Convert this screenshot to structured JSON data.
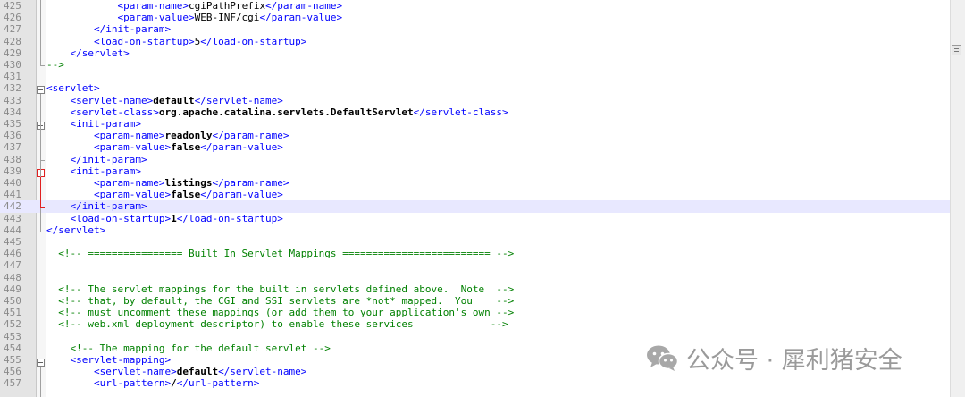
{
  "editor": {
    "lines": [
      {
        "n": "425",
        "code": [
          [
            "",
            "            "
          ],
          [
            "t",
            "<param-name>"
          ],
          [
            "",
            "cgiPathPrefix"
          ],
          [
            "t",
            "</param-name>"
          ]
        ]
      },
      {
        "n": "426",
        "code": [
          [
            "",
            "            "
          ],
          [
            "t",
            "<param-value>"
          ],
          [
            "",
            "WEB-INF/cgi"
          ],
          [
            "t",
            "</param-value>"
          ]
        ]
      },
      {
        "n": "427",
        "code": [
          [
            "",
            "        "
          ],
          [
            "t",
            "</init-param>"
          ]
        ]
      },
      {
        "n": "428",
        "code": [
          [
            "",
            "        "
          ],
          [
            "t",
            "<load-on-startup>"
          ],
          [
            "",
            "5"
          ],
          [
            "t",
            "</load-on-startup>"
          ]
        ]
      },
      {
        "n": "429",
        "code": [
          [
            "",
            "    "
          ],
          [
            "t",
            "</servlet>"
          ]
        ]
      },
      {
        "n": "430",
        "code": [
          [
            "c",
            "-->"
          ]
        ]
      },
      {
        "n": "431",
        "code": []
      },
      {
        "n": "432",
        "code": [
          [
            "t",
            "<servlet>"
          ]
        ]
      },
      {
        "n": "433",
        "code": [
          [
            "",
            "    "
          ],
          [
            "t",
            "<servlet-name>"
          ],
          [
            "v",
            "default"
          ],
          [
            "t",
            "</servlet-name>"
          ]
        ]
      },
      {
        "n": "434",
        "code": [
          [
            "",
            "    "
          ],
          [
            "t",
            "<servlet-class>"
          ],
          [
            "v",
            "org.apache.catalina.servlets.DefaultServlet"
          ],
          [
            "t",
            "</servlet-class>"
          ]
        ]
      },
      {
        "n": "435",
        "code": [
          [
            "",
            "    "
          ],
          [
            "t",
            "<init-param>"
          ]
        ]
      },
      {
        "n": "436",
        "code": [
          [
            "",
            "        "
          ],
          [
            "t",
            "<param-name>"
          ],
          [
            "v",
            "readonly"
          ],
          [
            "t",
            "</param-name>"
          ]
        ]
      },
      {
        "n": "437",
        "code": [
          [
            "",
            "        "
          ],
          [
            "t",
            "<param-value>"
          ],
          [
            "v",
            "false"
          ],
          [
            "t",
            "</param-value>"
          ]
        ]
      },
      {
        "n": "438",
        "code": [
          [
            "",
            "    "
          ],
          [
            "t",
            "</init-param>"
          ]
        ]
      },
      {
        "n": "439",
        "code": [
          [
            "",
            "    "
          ],
          [
            "t",
            "<init-param>"
          ]
        ]
      },
      {
        "n": "440",
        "code": [
          [
            "",
            "        "
          ],
          [
            "t",
            "<param-name>"
          ],
          [
            "v",
            "listings"
          ],
          [
            "t",
            "</param-name>"
          ]
        ]
      },
      {
        "n": "441",
        "code": [
          [
            "",
            "        "
          ],
          [
            "t",
            "<param-value>"
          ],
          [
            "v",
            "false"
          ],
          [
            "t",
            "</param-value>"
          ]
        ]
      },
      {
        "n": "442",
        "code": [
          [
            "",
            "    "
          ],
          [
            "t",
            "</init-param>"
          ]
        ],
        "highlight": true
      },
      {
        "n": "443",
        "code": [
          [
            "",
            "    "
          ],
          [
            "t",
            "<load-on-startup>"
          ],
          [
            "v",
            "1"
          ],
          [
            "t",
            "</load-on-startup>"
          ]
        ]
      },
      {
        "n": "444",
        "code": [
          [
            "t",
            "</servlet>"
          ]
        ]
      },
      {
        "n": "445",
        "code": []
      },
      {
        "n": "446",
        "code": [
          [
            "",
            "  "
          ],
          [
            "c",
            "<!-- ================ Built In Servlet Mappings ========================= -->"
          ]
        ]
      },
      {
        "n": "447",
        "code": []
      },
      {
        "n": "448",
        "code": []
      },
      {
        "n": "449",
        "code": [
          [
            "",
            "  "
          ],
          [
            "c",
            "<!-- The servlet mappings for the built in servlets defined above.  Note  -->"
          ]
        ]
      },
      {
        "n": "450",
        "code": [
          [
            "",
            "  "
          ],
          [
            "c",
            "<!-- that, by default, the CGI and SSI servlets are *not* mapped.  You    -->"
          ]
        ]
      },
      {
        "n": "451",
        "code": [
          [
            "",
            "  "
          ],
          [
            "c",
            "<!-- must uncomment these mappings (or add them to your application's own -->"
          ]
        ]
      },
      {
        "n": "452",
        "code": [
          [
            "",
            "  "
          ],
          [
            "c",
            "<!-- web.xml deployment descriptor) to enable these services             -->"
          ]
        ]
      },
      {
        "n": "453",
        "code": []
      },
      {
        "n": "454",
        "code": [
          [
            "",
            "    "
          ],
          [
            "c",
            "<!-- The mapping for the default servlet -->"
          ]
        ]
      },
      {
        "n": "455",
        "code": [
          [
            "",
            "    "
          ],
          [
            "t",
            "<servlet-mapping>"
          ]
        ]
      },
      {
        "n": "456",
        "code": [
          [
            "",
            "        "
          ],
          [
            "t",
            "<servlet-name>"
          ],
          [
            "v",
            "default"
          ],
          [
            "t",
            "</servlet-name>"
          ]
        ]
      },
      {
        "n": "457",
        "code": [
          [
            "",
            "        "
          ],
          [
            "t",
            "<url-pattern>"
          ],
          [
            "v",
            "/"
          ],
          [
            "t",
            "</url-pattern>"
          ]
        ]
      }
    ]
  },
  "colors": {
    "tag": "#0000ff",
    "comment": "#008000",
    "value": "#000000",
    "highlight": "#e8e8ff",
    "fold_active": "#e02020"
  },
  "watermark": {
    "text": "公众号 · 犀利猪安全",
    "icon": "wechat-icon"
  }
}
